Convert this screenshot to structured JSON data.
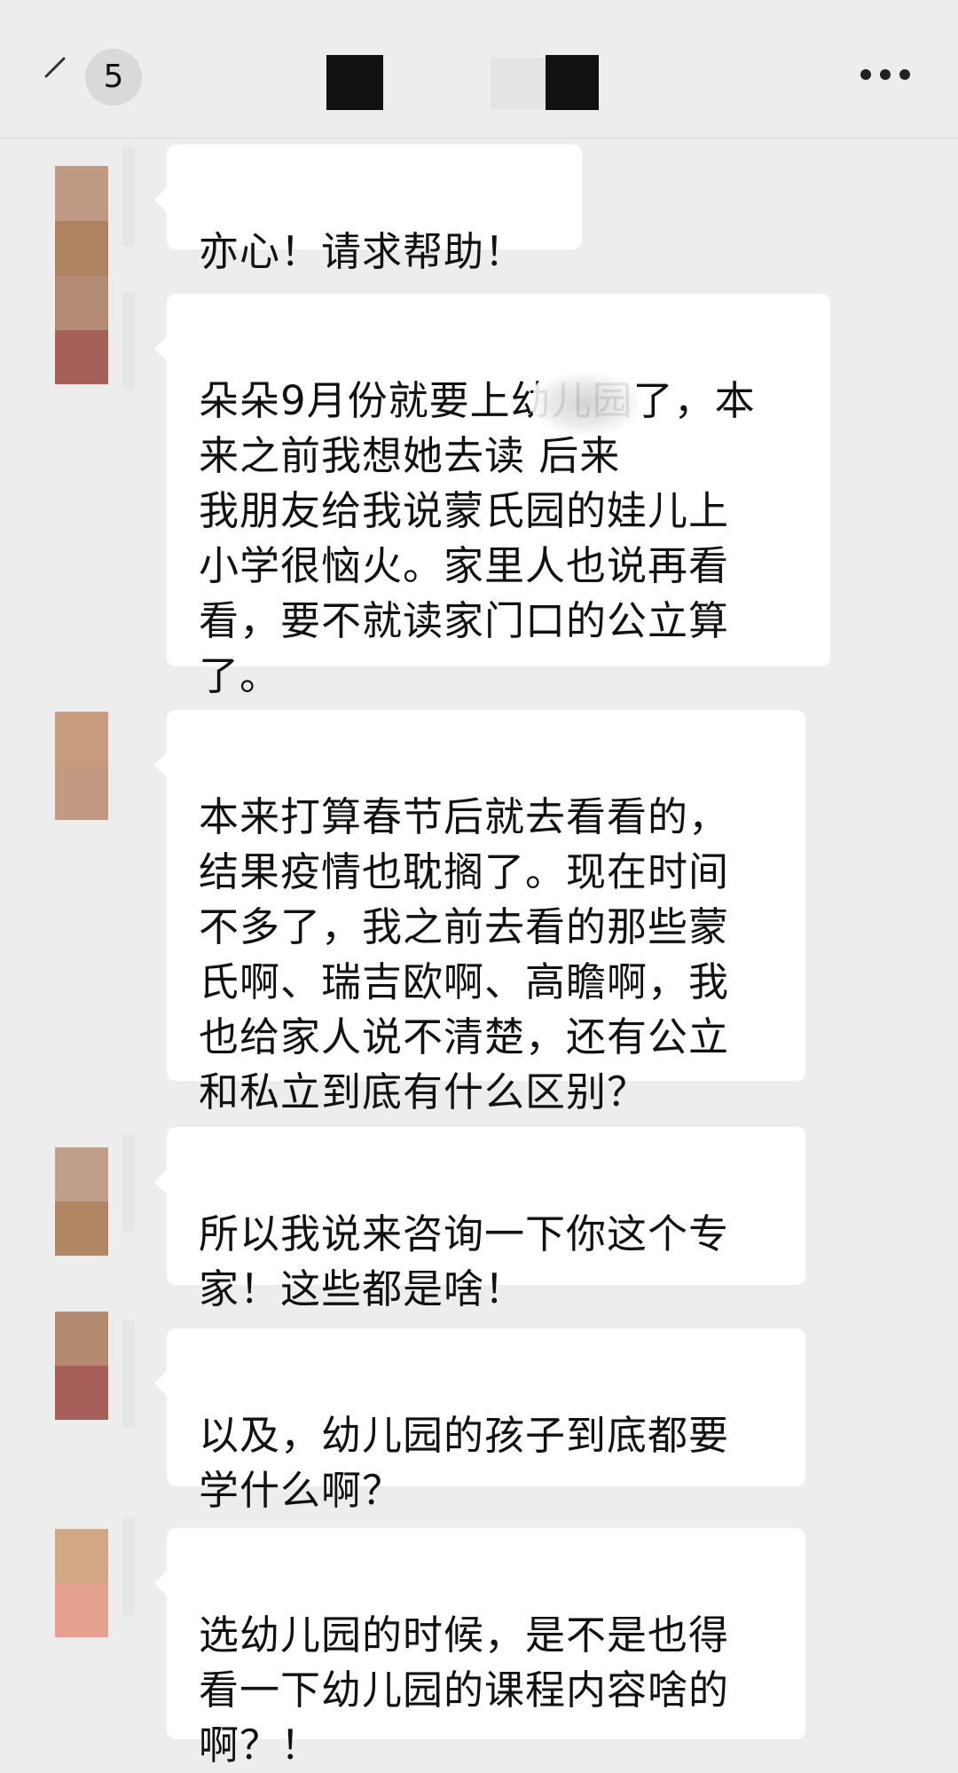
{
  "header": {
    "unread_count": "5",
    "back_icon": "back-chevron-icon",
    "more_icon": "more-dots-icon"
  },
  "messages": [
    {
      "sender": "contact",
      "text": "亦心！请求帮助！"
    },
    {
      "sender": "contact",
      "text": "朵朵9月份就要上幼儿园了，本\n来之前我想她去读         后来\n我朋友给我说蒙氏园的娃儿上\n小学很恼火。家里人也说再看\n看，要不就读家门口的公立算\n了。"
    },
    {
      "sender": "contact",
      "text": "本来打算春节后就去看看的，\n结果疫情也耽搁了。现在时间\n不多了，我之前去看的那些蒙\n氏啊、瑞吉欧啊、高瞻啊，我\n也给家人说不清楚，还有公立\n和私立到底有什么区别？"
    },
    {
      "sender": "contact",
      "text": "所以我说来咨询一下你这个专\n家！这些都是啥！"
    },
    {
      "sender": "contact",
      "text": "以及，幼儿园的孩子到底都要\n学什么啊？"
    },
    {
      "sender": "contact",
      "text": "选幼儿园的时候，是不是也得\n看一下幼儿园的课程内容啥的\n啊？！"
    }
  ],
  "colors": {
    "background": "#ededed",
    "bubble": "#ffffff",
    "text": "#111111"
  }
}
